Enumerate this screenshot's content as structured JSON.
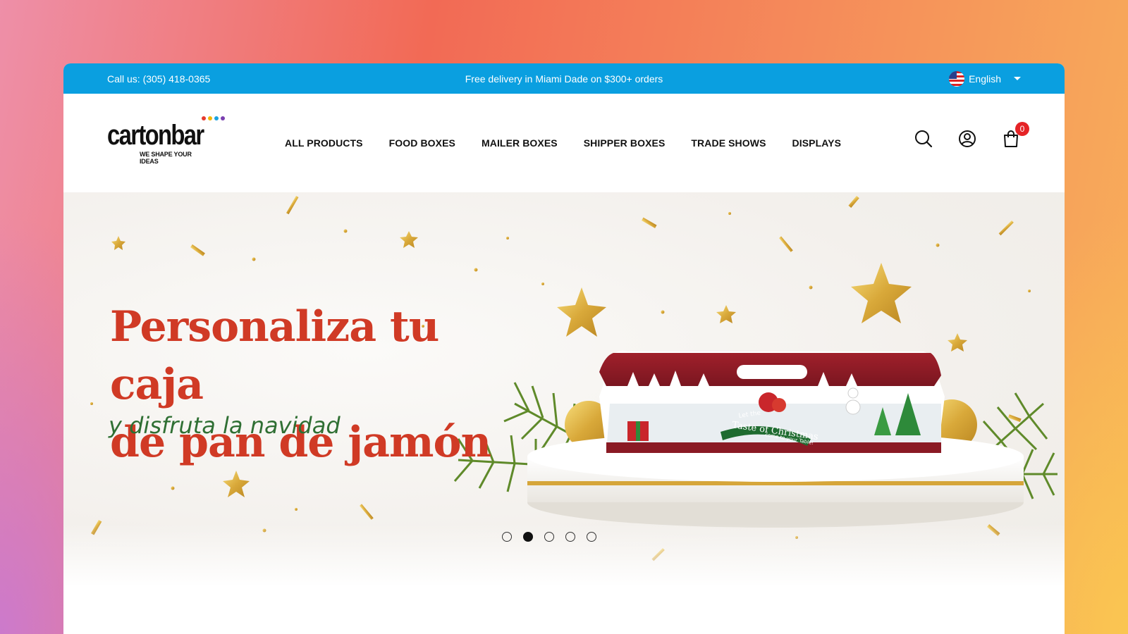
{
  "topbar": {
    "phone": "Call us: (305) 418-0365",
    "promo": "Free delivery in Miami Dade on $300+ orders",
    "language": "English"
  },
  "logo": {
    "wordmark": "cartonbar",
    "tagline": "WE SHAPE YOUR IDEAS",
    "dot_colors": [
      "#e63b2e",
      "#f2b705",
      "#1aa3e0",
      "#7a3fb0"
    ]
  },
  "nav": {
    "items": [
      "ALL PRODUCTS",
      "FOOD BOXES",
      "MAILER BOXES",
      "SHIPPER BOXES",
      "TRADE SHOWS",
      "DISPLAYS"
    ]
  },
  "header_icons": {
    "search": "search-icon",
    "account": "user-icon",
    "cart": "shopping-bag-icon",
    "cart_count": "0"
  },
  "hero": {
    "headline_line1": "Personaliza tu caja",
    "headline_line2": "de pan de jamón",
    "subline": "y disfruta la navidad",
    "box_text_line1": "Let the",
    "box_text_line2": "Taste of Christmas",
    "box_text_line3": "come to your Table!",
    "slides_total": 5,
    "active_slide": 2
  },
  "colors": {
    "topbar": "#0a9fe0",
    "headline": "#d03a25",
    "subline": "#2f6f33",
    "badge": "#e52326"
  }
}
